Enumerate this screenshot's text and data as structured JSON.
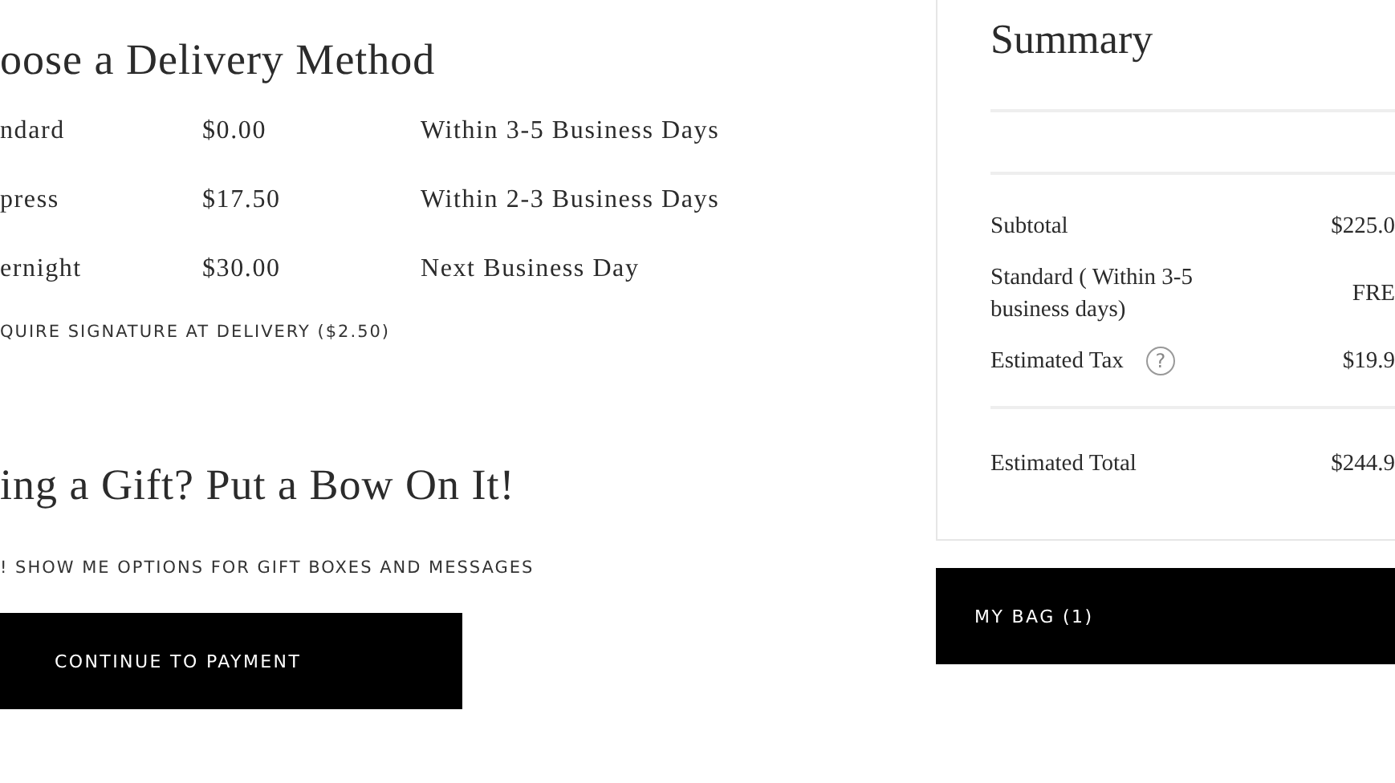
{
  "delivery": {
    "title": "oose a Delivery Method",
    "methods": [
      {
        "name": "ndard",
        "price": "$0.00",
        "time": "Within 3-5 Business Days"
      },
      {
        "name": "press",
        "price": "$17.50",
        "time": "Within 2-3 Business Days"
      },
      {
        "name": "ernight",
        "price": "$30.00",
        "time": "Next Business Day"
      }
    ],
    "signature_option": "QUIRE SIGNATURE AT DELIVERY ($2.50)"
  },
  "gift": {
    "title": "ing a Gift? Put a Bow On It!",
    "option": "! SHOW ME OPTIONS FOR GIFT BOXES AND MESSAGES"
  },
  "continue_button": "CONTINUE TO PAYMENT",
  "summary": {
    "title": "Summary",
    "rows": [
      {
        "label": "Subtotal",
        "value": "$225.0"
      },
      {
        "label": "Standard ( Within 3-5 business days)",
        "value": "FRE"
      },
      {
        "label": "Estimated Tax",
        "value": "$19.9",
        "help": "?"
      }
    ],
    "total": {
      "label": "Estimated Total",
      "value": "$244.9"
    }
  },
  "bag_button": "MY BAG (1)"
}
